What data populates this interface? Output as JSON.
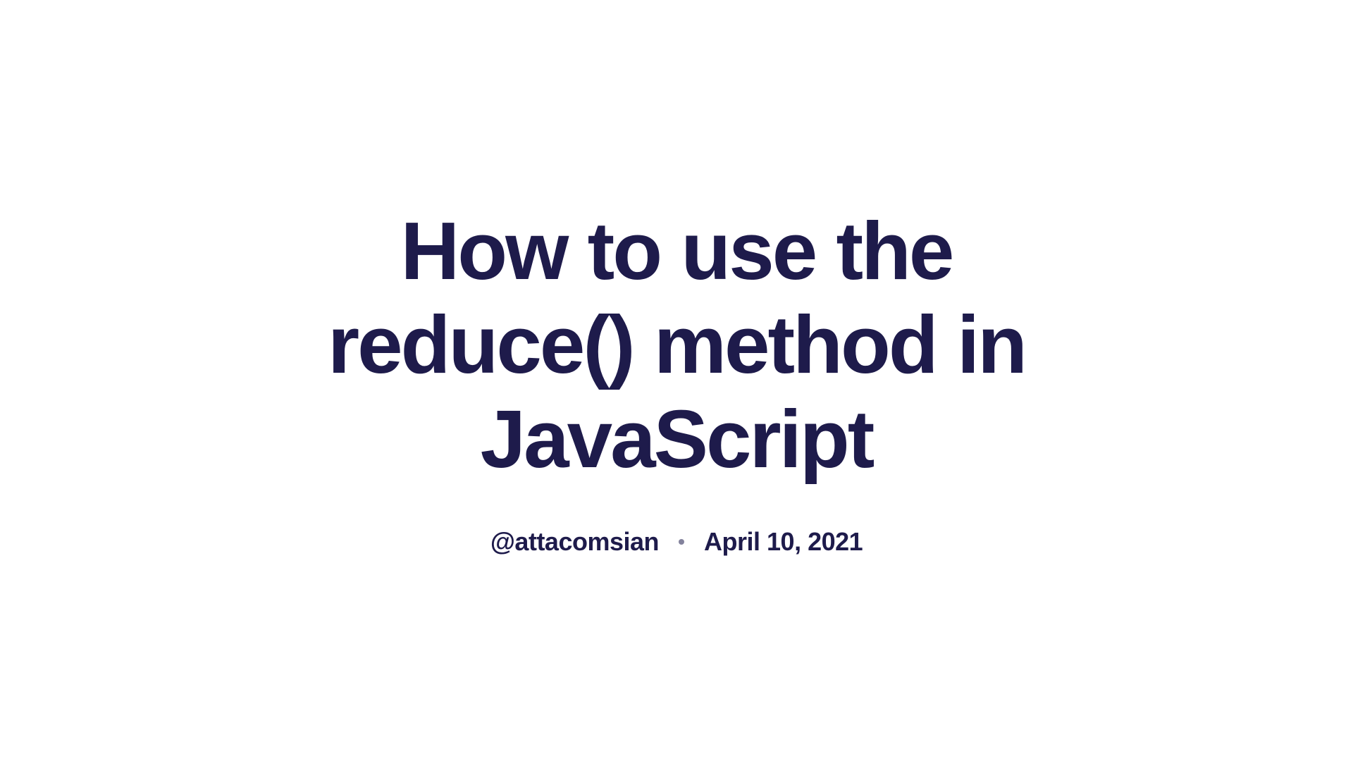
{
  "title": "How to use the reduce() method in JavaScript",
  "author_handle": "@attacomsian",
  "date": "April 10, 2021"
}
